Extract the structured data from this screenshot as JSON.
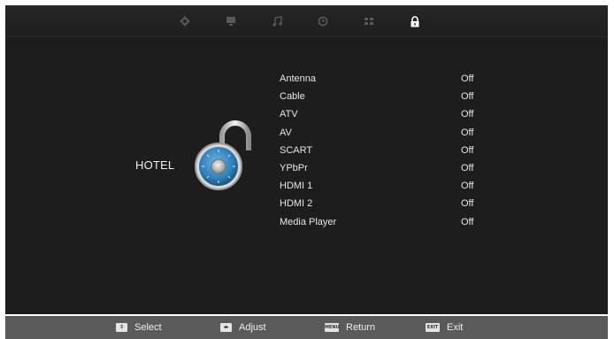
{
  "tabs": [
    {
      "name": "picture",
      "icon": "gear-icon",
      "active": false
    },
    {
      "name": "screen",
      "icon": "monitor-icon",
      "active": false
    },
    {
      "name": "sound",
      "icon": "music-note-icon",
      "active": false
    },
    {
      "name": "time",
      "icon": "clock-icon",
      "active": false
    },
    {
      "name": "setup",
      "icon": "grid-icon",
      "active": false
    },
    {
      "name": "lock",
      "icon": "lock-icon",
      "active": true
    }
  ],
  "category": "HOTEL",
  "sources": [
    {
      "label": "Antenna",
      "value": "Off"
    },
    {
      "label": "Cable",
      "value": "Off"
    },
    {
      "label": "ATV",
      "value": "Off"
    },
    {
      "label": "AV",
      "value": "Off"
    },
    {
      "label": "SCART",
      "value": "Off"
    },
    {
      "label": "YPbPr",
      "value": "Off"
    },
    {
      "label": "HDMI 1",
      "value": "Off"
    },
    {
      "label": "HDMI 2",
      "value": "Off"
    },
    {
      "label": "Media Player",
      "value": "Off"
    }
  ],
  "footer": {
    "select": {
      "key": "⇕",
      "label": "Select"
    },
    "adjust": {
      "key": "◂▸",
      "label": "Adjust"
    },
    "return": {
      "key": "MENU",
      "label": "Return"
    },
    "exit": {
      "key": "EXIT",
      "label": "Exit"
    }
  },
  "colors": {
    "background": "#1d1d1d",
    "footer": "#5a5a5a",
    "lock_dial": "#2f7fb8",
    "inactive_tab": "#5a5a5a",
    "active_tab": "#ffffff"
  }
}
